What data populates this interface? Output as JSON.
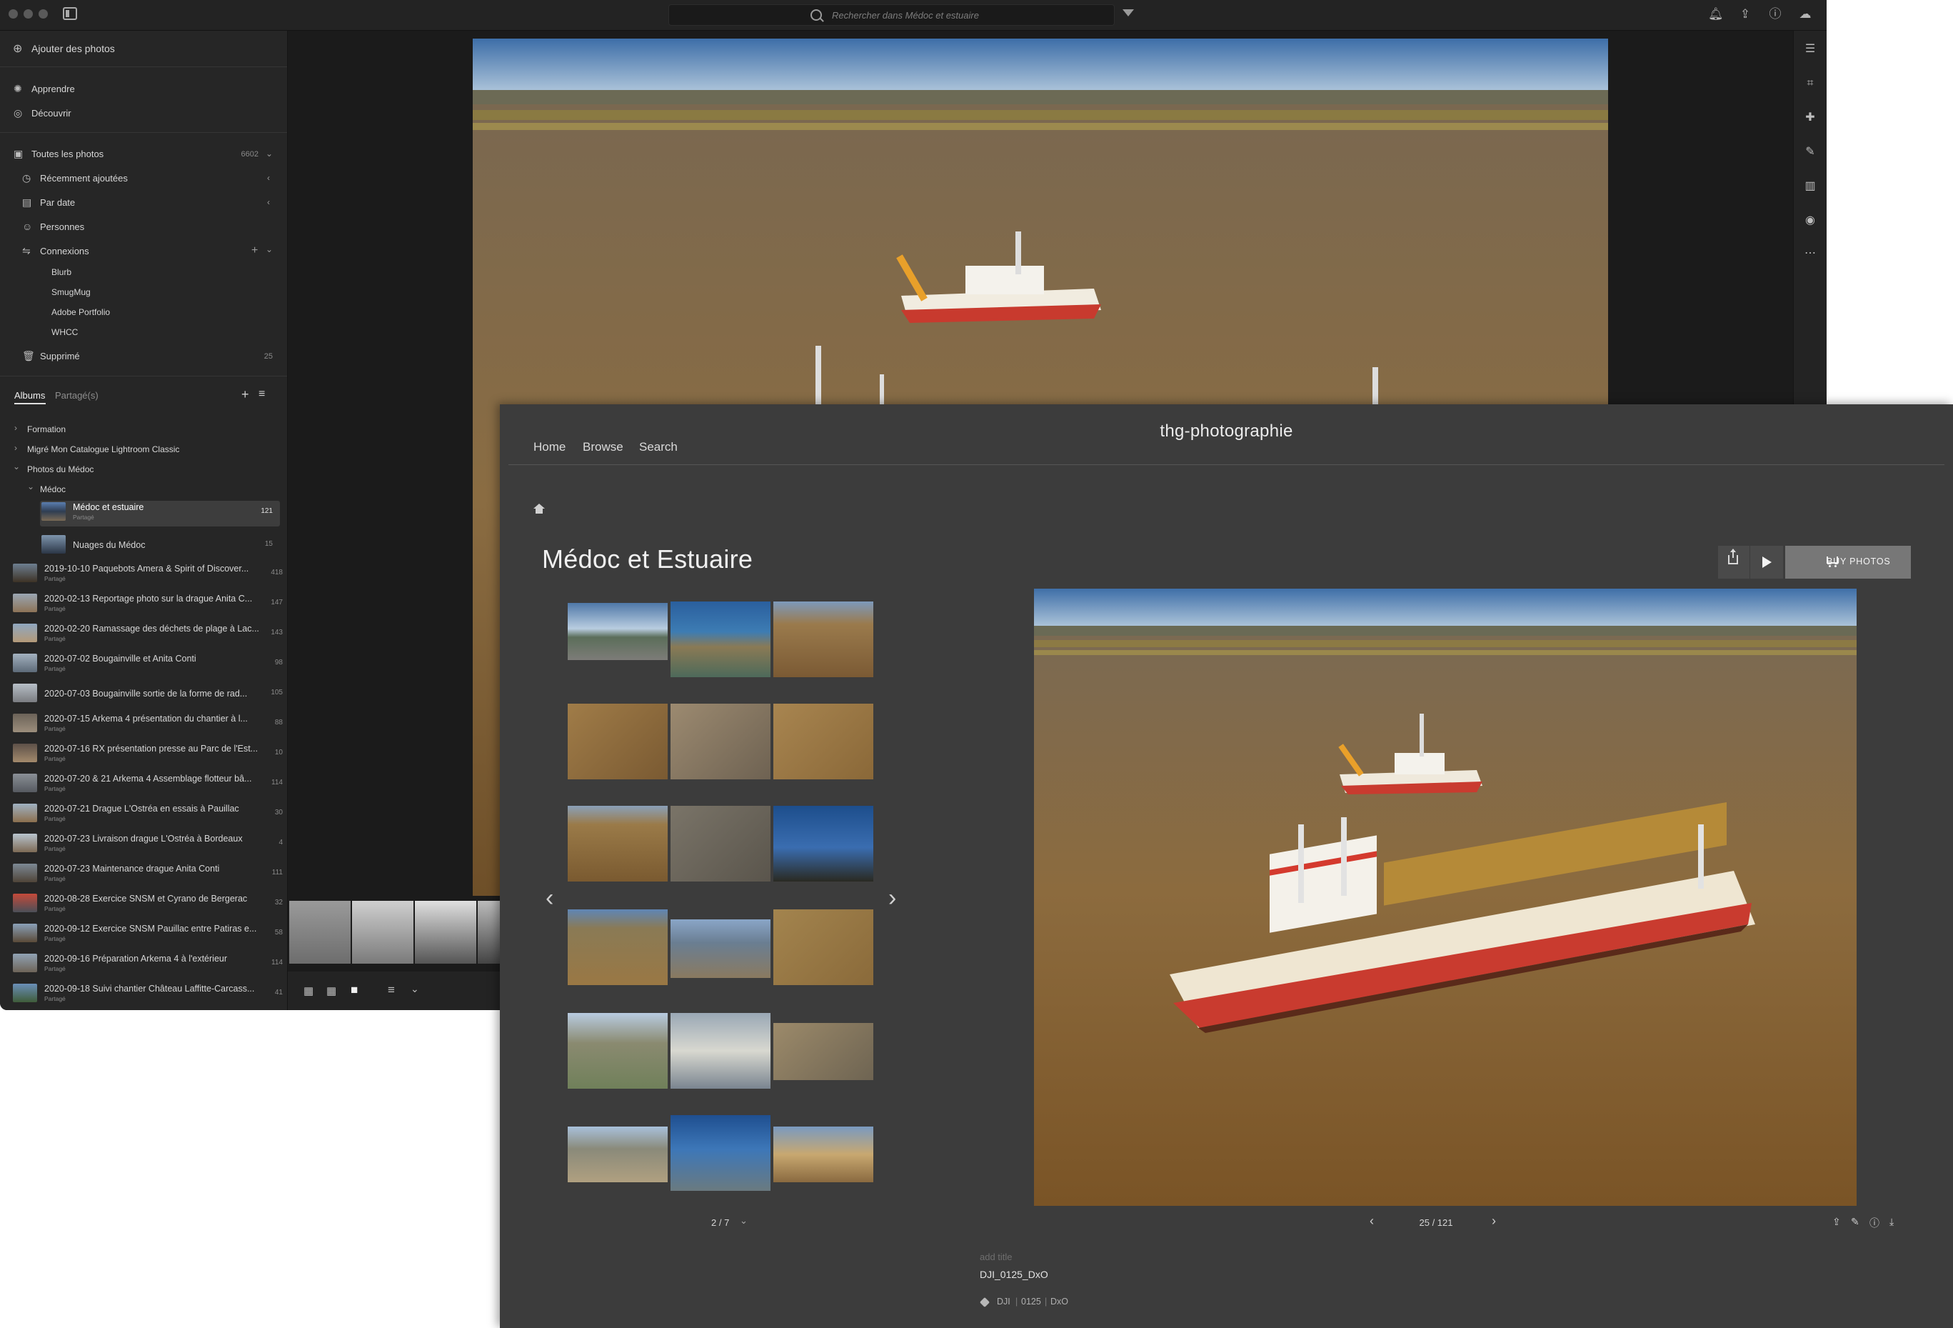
{
  "lightroom": {
    "search_placeholder": "Rechercher dans Médoc et estuaire",
    "add_photos": "Ajouter des photos",
    "learn": "Apprendre",
    "discover": "Découvrir",
    "all_photos": "Toutes les photos",
    "all_photos_count": "6602",
    "recently_added": "Récemment ajoutées",
    "by_date": "Par date",
    "people": "Personnes",
    "connections": "Connexions",
    "connection_items": [
      "Blurb",
      "SmugMug",
      "Adobe Portfolio",
      "WHCC"
    ],
    "deleted": "Supprimé",
    "deleted_count": "25",
    "tab_albums": "Albums",
    "tab_shared": "Partagé(s)",
    "folders": [
      "Formation",
      "Migré Mon Catalogue Lightroom Classic",
      "Photos du Médoc",
      "Médoc"
    ],
    "shared_label": "Partagé",
    "albums": [
      {
        "title": "Médoc et estuaire",
        "count": "121",
        "shared": true,
        "selected": true
      },
      {
        "title": "Nuages du Médoc",
        "count": "15",
        "shared": false
      },
      {
        "title": "2019-10-10 Paquebots Amera & Spirit of Discover...",
        "count": "418",
        "shared": true
      },
      {
        "title": "2020-02-13 Reportage photo sur la drague Anita C...",
        "count": "147",
        "shared": true
      },
      {
        "title": "2020-02-20 Ramassage des déchets de plage à Lac...",
        "count": "143",
        "shared": true
      },
      {
        "title": "2020-07-02 Bougainville et Anita Conti",
        "count": "98",
        "shared": true
      },
      {
        "title": "2020-07-03 Bougainville sortie de la forme de rad...",
        "count": "105",
        "shared": false
      },
      {
        "title": "2020-07-15 Arkema 4 présentation du chantier à l...",
        "count": "88",
        "shared": true
      },
      {
        "title": "2020-07-16 RX présentation presse au Parc de l'Est...",
        "count": "10",
        "shared": true
      },
      {
        "title": "2020-07-20 & 21 Arkema 4 Assemblage flotteur bâ...",
        "count": "114",
        "shared": true
      },
      {
        "title": "2020-07-21 Drague L'Ostréa en essais à Pauillac",
        "count": "30",
        "shared": true
      },
      {
        "title": "2020-07-23 Livraison drague L'Ostréa à Bordeaux",
        "count": "4",
        "shared": true
      },
      {
        "title": "2020-07-23 Maintenance drague Anita Conti",
        "count": "111",
        "shared": true
      },
      {
        "title": "2020-08-28 Exercice SNSM et Cyrano de Bergerac",
        "count": "32",
        "shared": true
      },
      {
        "title": "2020-09-12 Exercice SNSM Pauillac entre Patiras e...",
        "count": "58",
        "shared": true
      },
      {
        "title": "2020-09-16 Préparation Arkema 4 à l'extérieur",
        "count": "114",
        "shared": true
      },
      {
        "title": "2020-09-18 Suivi chantier Château Laffitte-Carcass...",
        "count": "41",
        "shared": true
      }
    ]
  },
  "web": {
    "brand": "thg-photographie",
    "nav": [
      "Home",
      "Browse",
      "Search"
    ],
    "album_title": "Médoc et Estuaire",
    "buy_label": "BUY PHOTOS",
    "thumb_page": "2 / 7",
    "photo_counter": "25 / 121",
    "add_title": "add title",
    "file_name": "DJI_0125_DxO",
    "tags": [
      "DJI",
      "0125",
      "DxO"
    ]
  },
  "colors": {
    "lr_bg": "#1e1e1e",
    "web_bg": "#3c3c3c",
    "buy_button": "#777777"
  }
}
